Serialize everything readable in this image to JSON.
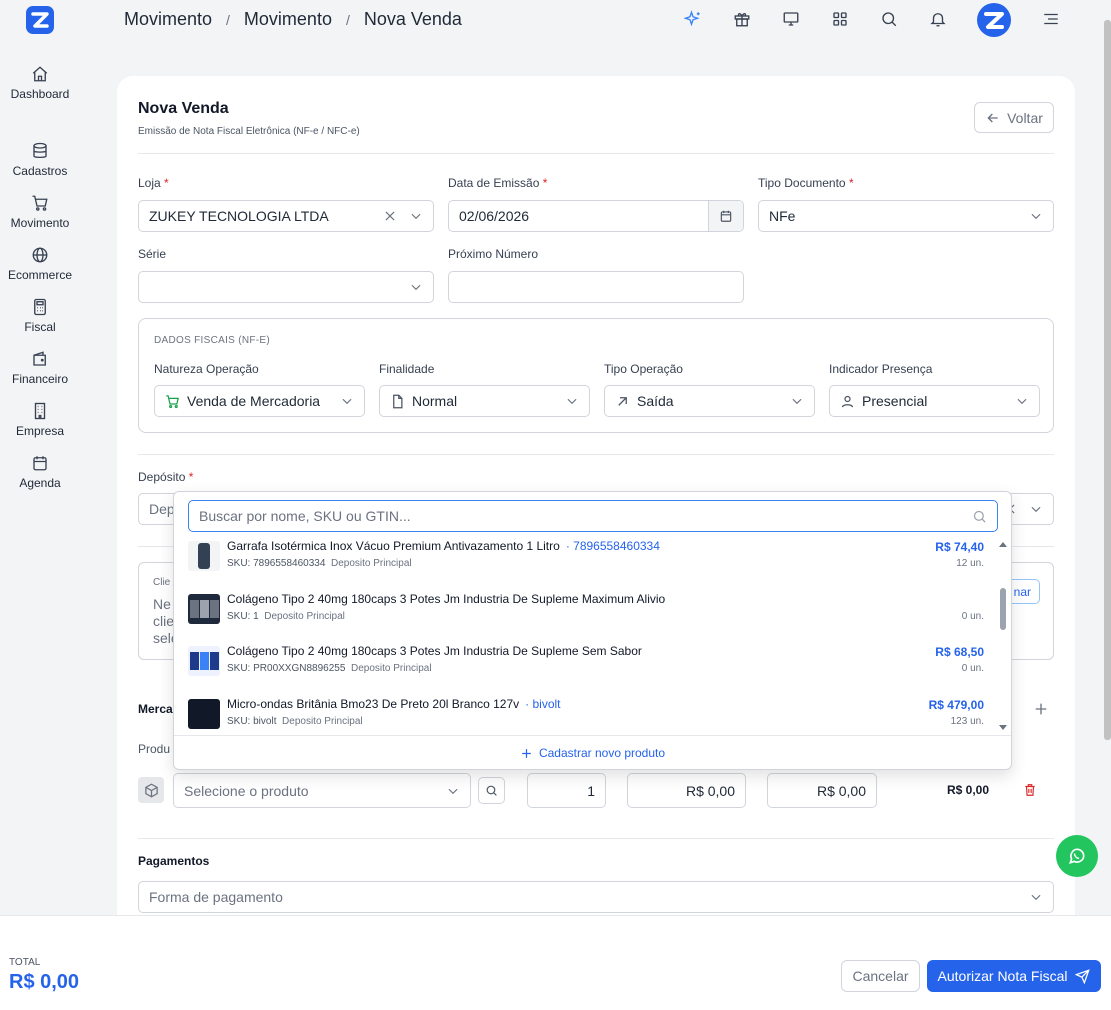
{
  "breadcrumb": [
    "Movimento",
    "Movimento",
    "Nova Venda"
  ],
  "sidebar": {
    "items": [
      {
        "label": "Dashboard",
        "icon": "home-icon"
      },
      {
        "label": "Cadastros",
        "icon": "database-icon"
      },
      {
        "label": "Movimento",
        "icon": "cart-icon"
      },
      {
        "label": "Ecommerce",
        "icon": "globe-icon"
      },
      {
        "label": "Fiscal",
        "icon": "calculator-icon"
      },
      {
        "label": "Financeiro",
        "icon": "wallet-icon"
      },
      {
        "label": "Empresa",
        "icon": "building-icon"
      },
      {
        "label": "Agenda",
        "icon": "calendar-icon"
      }
    ]
  },
  "page": {
    "title": "Nova Venda",
    "subtitle": "Emissão de Nota Fiscal Eletrônica (NF-e / NFC-e)",
    "back_label": "Voltar"
  },
  "form": {
    "loja_label": "Loja",
    "loja_value": "ZUKEY TECNOLOGIA LTDA",
    "data_label": "Data de Emissão",
    "data_value": "02/06/2026",
    "tipo_label": "Tipo Documento",
    "tipo_value": "NFe",
    "serie_label": "Série",
    "serie_value": "",
    "proximo_label": "Próximo Número",
    "proximo_value": "",
    "required_mark": "*"
  },
  "fiscal": {
    "title": "DADOS FISCAIS (NF-E)",
    "natureza_label": "Natureza Operação",
    "natureza_value": "Venda de Mercadoria",
    "finalidade_label": "Finalidade",
    "finalidade_value": "Normal",
    "operacao_label": "Tipo Operação",
    "operacao_value": "Saída",
    "presenca_label": "Indicador Presença",
    "presenca_value": "Presencial"
  },
  "deposito": {
    "label": "Depósito",
    "value_partial": "Dep"
  },
  "cliente": {
    "label_partial": "Clie",
    "text_partial_1": "Ne",
    "text_partial_2": "clie",
    "text_partial_3": "sele",
    "button_partial": "nar"
  },
  "mercadorias": {
    "label_partial": "Merca",
    "col_partial": "Produ",
    "product_placeholder": "Selecione o produto",
    "quantity": "1",
    "unit_price": "R$ 0,00",
    "discount": "R$ 0,00",
    "line_total": "R$ 0,00"
  },
  "dropdown": {
    "search_placeholder": "Buscar por nome, SKU ou GTIN...",
    "items": [
      {
        "name": "Garrafa Isotérmica Inox Vácuo Premium Antivazamento 1 Litro",
        "tag": "· 7896558460334",
        "sku_label": "SKU:",
        "sku": "7896558460334",
        "deposit": "Deposito Principal",
        "price": "R$ 74,40",
        "stock": "12 un."
      },
      {
        "name": "Colágeno Tipo 2 40mg 180caps 3 Potes Jm Industria De Supleme Maximum Alivio",
        "tag": "",
        "sku_label": "SKU:",
        "sku": "1",
        "deposit": "Deposito Principal",
        "price": "",
        "stock": "0 un."
      },
      {
        "name": "Colágeno Tipo 2 40mg 180caps 3 Potes Jm Industria De Supleme Sem Sabor",
        "tag": "",
        "sku_label": "SKU:",
        "sku": "PR00XXGN8896255",
        "deposit": "Deposito Principal",
        "price": "R$ 68,50",
        "stock": "0 un."
      },
      {
        "name": "Micro-ondas Britânia Bmo23 De Preto 20l Branco 127v",
        "tag": "· bivolt",
        "sku_label": "SKU:",
        "sku": "bivolt",
        "deposit": "Deposito Principal",
        "price": "R$ 479,00",
        "stock": "123 un."
      }
    ],
    "new_product_label": "Cadastrar novo produto"
  },
  "pagamentos": {
    "label": "Pagamentos",
    "placeholder": "Forma de pagamento"
  },
  "footer": {
    "total_label": "TOTAL",
    "total_value": "R$ 0,00",
    "cancel_label": "Cancelar",
    "authorize_label": "Autorizar Nota Fiscal"
  },
  "colors": {
    "accent": "#2563eb",
    "whatsapp": "#22c55e",
    "required": "#dc2626"
  }
}
